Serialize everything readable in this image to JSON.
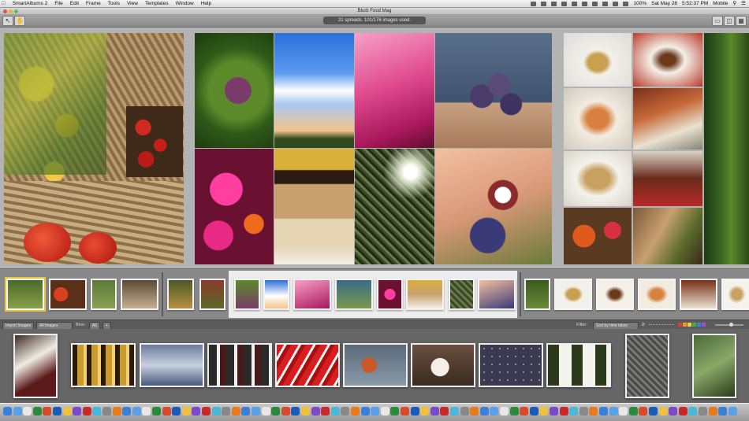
{
  "menubar": {
    "app_name": "SmartAlbums 2",
    "items": [
      "File",
      "Edit",
      "Frame",
      "Tools",
      "View",
      "Templates",
      "Window",
      "Help"
    ],
    "status_right": {
      "percent": "100%",
      "date": "Sat May 28",
      "time": "5:52:37 PM",
      "user": "Mobile"
    }
  },
  "window": {
    "title": "Blurb Food Mag"
  },
  "toolbar": {
    "status_text": "21 spreads. 101/176 images used.",
    "left_tools": [
      {
        "name": "pointer-tool-icon",
        "glyph": "↖"
      },
      {
        "name": "hand-tool-icon",
        "glyph": "✋"
      }
    ],
    "right_tools": [
      {
        "name": "single-view-icon",
        "glyph": "▭"
      },
      {
        "name": "split-view-icon",
        "glyph": "◫"
      },
      {
        "name": "grid-view-icon",
        "glyph": "▦"
      }
    ]
  },
  "images_bar": {
    "import_label": "Import Images",
    "source_value": "All Images",
    "bins_label": "Bins:",
    "bins_value": "All",
    "bins_add": "+",
    "filter_label": "Filter:",
    "sort_value": "Sort by time taken"
  },
  "colors": {
    "color_labels": [
      "#e23a3a",
      "#f09a2a",
      "#f1d23a",
      "#3fae4a",
      "#3f7fe0",
      "#9b55c8"
    ]
  },
  "dock_icon_count": 74
}
